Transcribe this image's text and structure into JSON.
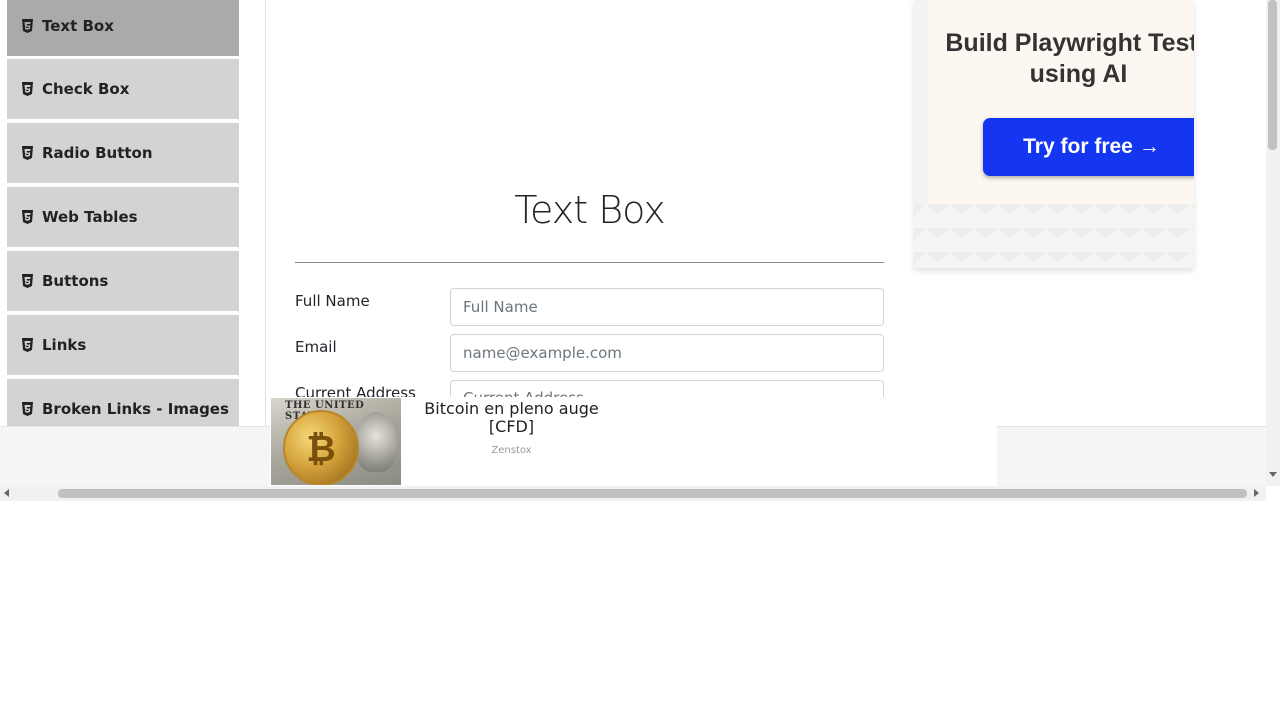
{
  "sidebar": {
    "items": [
      {
        "label": "Text Box",
        "icon": "html5-icon"
      },
      {
        "label": "Check Box",
        "icon": "html5-icon"
      },
      {
        "label": "Radio Button",
        "icon": "html5-icon"
      },
      {
        "label": "Web Tables",
        "icon": "html5-icon"
      },
      {
        "label": "Buttons",
        "icon": "html5-icon"
      },
      {
        "label": "Links",
        "icon": "html5-icon"
      },
      {
        "label": "Broken Links - Images",
        "icon": "html5-icon"
      }
    ],
    "active_item": "Text Box"
  },
  "main": {
    "title": "Text Box",
    "form": {
      "full_name_label": "Full Name",
      "full_name_placeholder": "Full Name",
      "email_label": "Email",
      "email_placeholder": "name@example.com",
      "address_label": "Current Address",
      "address_placeholder": "Current Address"
    }
  },
  "right_ad": {
    "headline": "Build Playwright Tests using AI",
    "cta_label": "Try for free",
    "cta_arrow": "→",
    "cta_color": "#1436f0"
  },
  "bottom_ad": {
    "text": "Bitcoin en pleno auge [CFD]",
    "source": "Zenstox",
    "image_caption": "THE UNITED STATES"
  },
  "colors": {
    "sidebar_item_bg": "#d3d3d3",
    "sidebar_active_bg": "#aaaaaa"
  }
}
